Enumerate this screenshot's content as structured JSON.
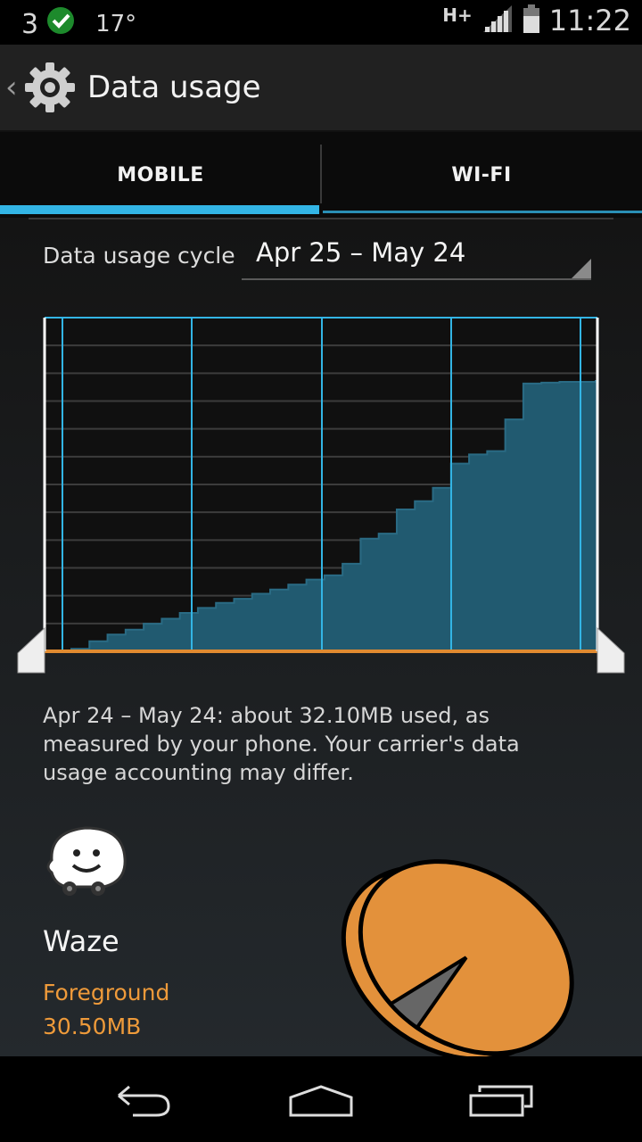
{
  "status": {
    "carrier_count": "3",
    "temperature": "17°",
    "network": "H+",
    "time": "11:22"
  },
  "header": {
    "title": "Data usage"
  },
  "tabs": [
    {
      "label": "MOBILE",
      "selected": true
    },
    {
      "label": "WI-FI",
      "selected": false
    }
  ],
  "cycle": {
    "label": "Data usage cycle",
    "value": "Apr 25 – May 24"
  },
  "chart_data": {
    "type": "area",
    "xlabel": "",
    "ylabel": "",
    "x": [
      0,
      1,
      2,
      3,
      4,
      5,
      6,
      7,
      8,
      9,
      10,
      11,
      12,
      13,
      14,
      15,
      16,
      17,
      18,
      19,
      20,
      21,
      22,
      23,
      24,
      25,
      26,
      27,
      28,
      29
    ],
    "cumulative_mb": [
      0.3,
      1.2,
      2.0,
      2.6,
      3.3,
      3.9,
      4.6,
      5.2,
      5.8,
      6.3,
      6.9,
      7.4,
      8.0,
      8.6,
      9.1,
      10.5,
      13.5,
      14.1,
      17.0,
      18.0,
      19.6,
      22.5,
      23.6,
      24.0,
      27.8,
      32.1,
      32.2,
      32.3,
      32.3,
      32.4
    ],
    "colors": {
      "fill": "#215a70",
      "outline": "#2a6b84",
      "grid": "#3c3c3c",
      "cycle_lines": "#33b5e5",
      "warning_line": "#e08a30",
      "handles": "#ffffff"
    }
  },
  "summary": "Apr 24 – May 24: about 32.10MB used, as measured by your phone. Your carrier's data usage accounting may differ.",
  "app": {
    "name": "Waze",
    "foreground_label": "Foreground",
    "foreground_size": "30.50MB",
    "icon": "waze-icon",
    "pie": {
      "foreground_fraction": 0.95,
      "color": "#e3913b"
    }
  },
  "nav": {
    "back": "back-icon",
    "home": "home-icon",
    "recents": "recents-icon"
  }
}
